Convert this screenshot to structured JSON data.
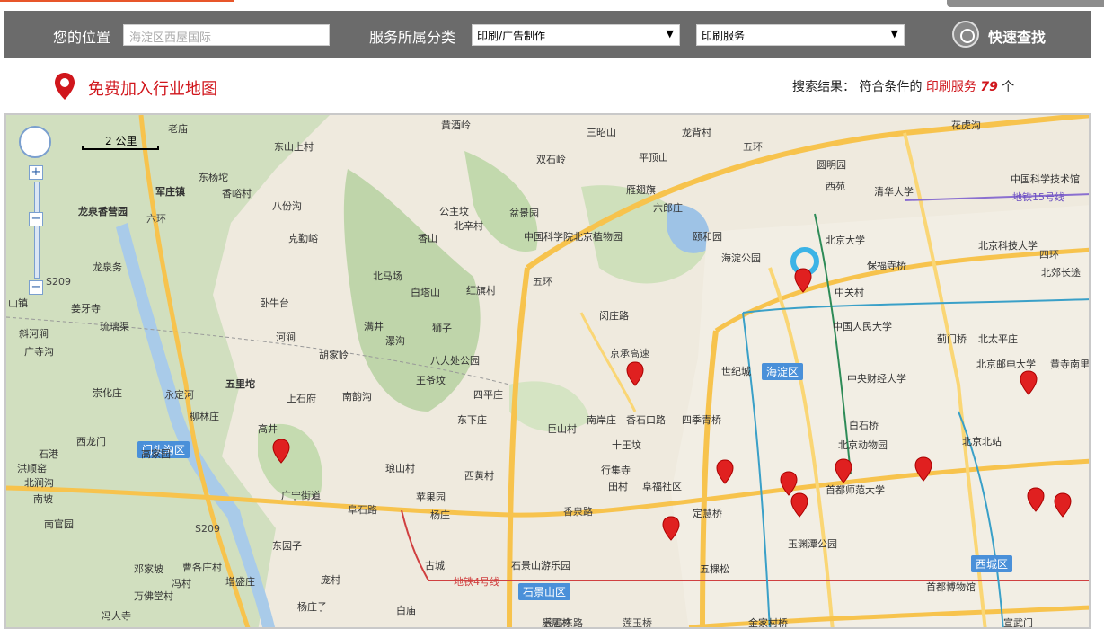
{
  "search": {
    "location_label": "您的位置",
    "location_placeholder": "海淀区西屋国际",
    "category_label": "服务所属分类",
    "category_selected": "印刷/广告制作",
    "subcategory_selected": "印刷服务",
    "quick_find_label": "快速查找"
  },
  "join": {
    "link_label": "免费加入行业地图"
  },
  "result": {
    "prefix": "搜索结果：",
    "match_text": "符合条件的",
    "category": "印刷服务",
    "count": "79",
    "unit": "个"
  },
  "map": {
    "scale_label": "2 公里",
    "districts": [
      {
        "name": "海淀区"
      },
      {
        "name": "门头沟区"
      },
      {
        "name": "石景山区"
      },
      {
        "name": "西城区"
      }
    ],
    "place_labels": [
      "黄酒岭",
      "老庙",
      "东山上村",
      "三昭山",
      "龙背村",
      "花虎沟",
      "双石岭",
      "平顶山",
      "圆明园",
      "西苑",
      "清华大学",
      "中国科学技术馆",
      "军庄镇",
      "东杨坨",
      "香峪村",
      "八份沟",
      "雁翅旗",
      "六郎庄",
      "颐和园",
      "龙泉香营园",
      "公主坟",
      "北辛村",
      "盆景园",
      "中国科学院北京植物园",
      "香山",
      "北京大学",
      "北京科技大学",
      "克勤峪",
      "海淀公园",
      "保福寺桥",
      "北郊长途",
      "龙泉务",
      "北马场",
      "白塔山",
      "红旗村",
      "中关村",
      "山镇",
      "卧牛台",
      "姜牙寺",
      "闵庄路",
      "中国人民大学",
      "蓟门桥",
      "北太平庄",
      "斜河涧",
      "琉璃渠",
      "满井",
      "狮子",
      "河涧",
      "瀑沟",
      "广寺沟",
      "胡家岭",
      "八大处公园",
      "北京邮电大学",
      "黄寺南里",
      "王爷坟",
      "世纪城",
      "中央财经大学",
      "五里坨",
      "上石府",
      "南韵沟",
      "四平庄",
      "崇化庄",
      "东下庄",
      "南岸庄",
      "香石口路",
      "四季青桥",
      "白石桥",
      "柳林庄",
      "巨山村",
      "高井",
      "北京动物园",
      "北京北站",
      "西龙门",
      "十王坟",
      "石港",
      "洪顺窑",
      "北涧沟",
      "琅山村",
      "西黄村",
      "行集寺",
      "首都师范大学",
      "高家园",
      "田村",
      "阜福社区",
      "南坡",
      "广宁街道",
      "苹果园",
      "杨庄",
      "定慧桥",
      "南官园",
      "东园子",
      "玉渊潭公园",
      "邓家坡",
      "曹各庄村",
      "冯村",
      "庞村",
      "古城",
      "石景山游乐园",
      "五棵松",
      "首都博物馆",
      "万佛堂村",
      "增盛庄",
      "冯人寺",
      "杨庄子",
      "白庙",
      "金家村桥",
      "宣武门",
      "乐居林"
    ],
    "road_labels": [
      "五环",
      "四环",
      "六环",
      "阜石路",
      "地铁4号线",
      "地铁15号线",
      "五环",
      "S209",
      "S209",
      "永定河",
      "莲石东路",
      "莲玉桥",
      "香泉路",
      "京承高速"
    ]
  }
}
